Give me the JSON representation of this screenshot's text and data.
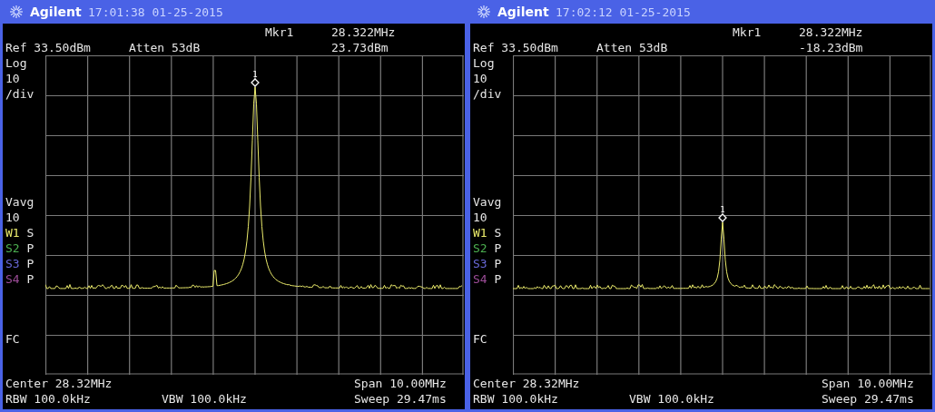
{
  "panels": [
    {
      "title_bar": {
        "brand": "Agilent",
        "timestamp": "17:01:38 01-25-2015"
      },
      "marker": {
        "name": "Mkr1",
        "frequency": "28.322MHz",
        "amplitude": "23.73dBm",
        "label": "1"
      },
      "ref": "Ref 33.50dBm",
      "atten": "Atten 53dB",
      "scale": [
        "Log",
        "10",
        "/div"
      ],
      "average": [
        "Vavg",
        "10"
      ],
      "traces": [
        {
          "id": "W1",
          "mode": "S",
          "color": "#ecec6c"
        },
        {
          "id": "S2",
          "mode": "P",
          "color": "#4caf50"
        },
        {
          "id": "S3",
          "mode": "P",
          "color": "#6868d8"
        },
        {
          "id": "S4",
          "mode": "P",
          "color": "#9c4c98"
        }
      ],
      "coupling": "FC",
      "center": "Center 28.32MHz",
      "span": "Span 10.00MHz",
      "rbw": "RBW 100.0kHz",
      "vbw": "VBW 100.0kHz",
      "sweep": "Sweep 29.47ms"
    },
    {
      "title_bar": {
        "brand": "Agilent",
        "timestamp": "17:02:12 01-25-2015"
      },
      "marker": {
        "name": "Mkr1",
        "frequency": "28.322MHz",
        "amplitude": "-18.23dBm",
        "label": "1"
      },
      "ref": "Ref 33.50dBm",
      "atten": "Atten 53dB",
      "scale": [
        "Log",
        "10",
        "/div"
      ],
      "average": [
        "Vavg",
        "10"
      ],
      "traces": [
        {
          "id": "W1",
          "mode": "S",
          "color": "#ecec6c"
        },
        {
          "id": "S2",
          "mode": "P",
          "color": "#4caf50"
        },
        {
          "id": "S3",
          "mode": "P",
          "color": "#6868d8"
        },
        {
          "id": "S4",
          "mode": "P",
          "color": "#9c4c98"
        }
      ],
      "coupling": "FC",
      "center": "Center 28.32MHz",
      "span": "Span 10.00MHz",
      "rbw": "RBW 100.0kHz",
      "vbw": "VBW 100.0kHz",
      "sweep": "Sweep 29.47ms"
    }
  ]
}
